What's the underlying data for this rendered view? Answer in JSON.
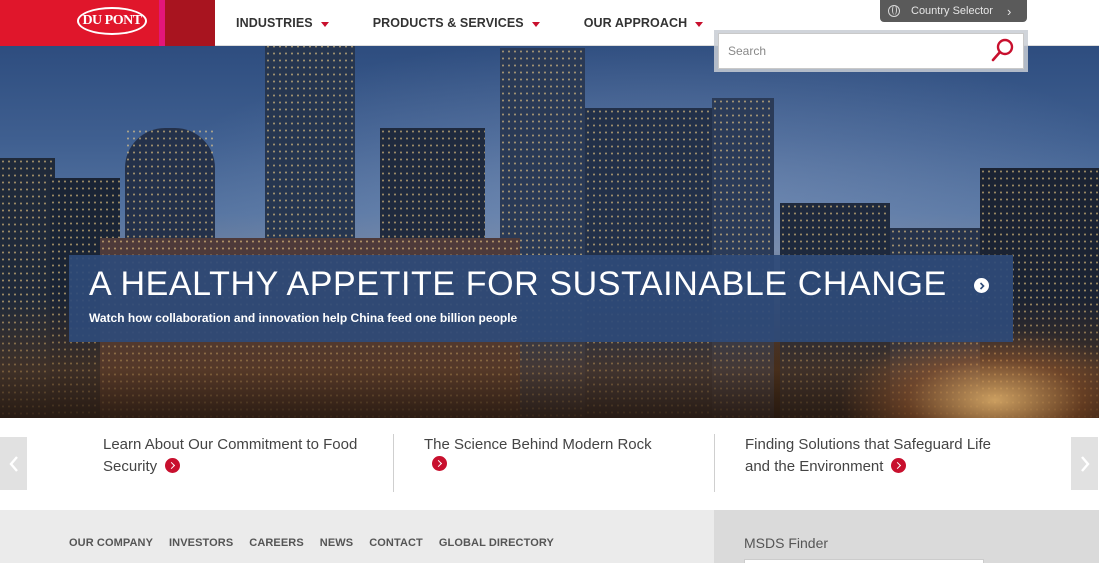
{
  "header": {
    "logo_text": "DU PONT",
    "nav": [
      {
        "label": "INDUSTRIES"
      },
      {
        "label": "PRODUCTS & SERVICES"
      },
      {
        "label": "OUR APPROACH"
      }
    ],
    "country_selector": "Country Selector"
  },
  "search": {
    "placeholder": "Search"
  },
  "hero": {
    "title": "A HEALTHY APPETITE FOR SUSTAINABLE CHANGE",
    "subtitle": "Watch how collaboration and innovation help China feed one billion people"
  },
  "features": [
    {
      "text": "Learn About Our Commitment to Food Security"
    },
    {
      "text": "The Science Behind Modern Rock"
    },
    {
      "text": "Finding Solutions that Safeguard Life and the Environment"
    }
  ],
  "footer": {
    "links": [
      "OUR COMPANY",
      "INVESTORS",
      "CAREERS",
      "NEWS",
      "CONTACT",
      "GLOBAL DIRECTORY"
    ],
    "msds_title": "MSDS Finder"
  },
  "colors": {
    "brand_red": "#e0162b",
    "accent_pink": "#e3167a",
    "banner_blue": "#2e4a78"
  }
}
